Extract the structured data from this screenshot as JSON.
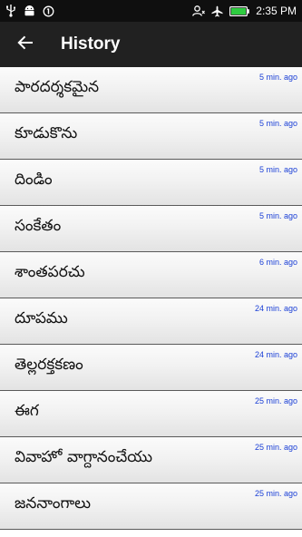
{
  "status_bar": {
    "time": "2:35 PM",
    "icons": [
      "usb-icon",
      "android-icon",
      "data-saver-icon",
      "person-icon",
      "airplane-icon",
      "battery-icon"
    ],
    "battery_color": "#2ecc40"
  },
  "app_bar": {
    "title": "History",
    "back_icon": "arrow-back-icon",
    "background": "#212121"
  },
  "history": {
    "time_color": "#1a3fd6",
    "items": [
      {
        "word": "పారదర్శకమైన",
        "time": "5 min. ago"
      },
      {
        "word": "కూడుకొను",
        "time": "5 min. ago"
      },
      {
        "word": "దిండిం",
        "time": "5 min. ago"
      },
      {
        "word": "సంకేతం",
        "time": "5 min. ago"
      },
      {
        "word": "శాంతపరచు",
        "time": "6 min. ago"
      },
      {
        "word": "దూపము",
        "time": "24 min. ago"
      },
      {
        "word": "తెల్లరక్తకణం",
        "time": "24 min. ago"
      },
      {
        "word": "ఈగ",
        "time": "25 min. ago"
      },
      {
        "word": "వివాహో వాగ్దానంచేయు",
        "time": "25 min. ago"
      },
      {
        "word": "జననాంగాలు",
        "time": "25 min. ago"
      }
    ]
  }
}
